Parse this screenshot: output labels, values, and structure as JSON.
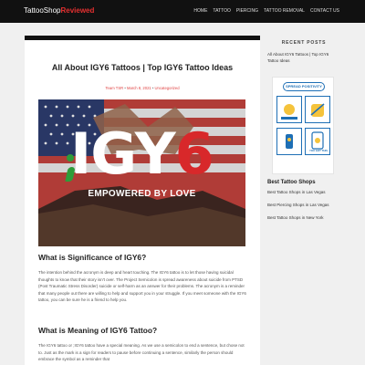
{
  "site": {
    "logo_part1": "TattooShop",
    "logo_part2": "Reviewed"
  },
  "nav": {
    "items": [
      "HOME",
      "TATTOO",
      "PIERCING",
      "TATTOO REMOVAL",
      "CONTACT US"
    ]
  },
  "article": {
    "title": "All About IGY6 Tattoos | Top IGY6 Tattoo Ideas",
    "author": "Team TSR",
    "date": "March 8, 2021",
    "category": "Uncategorized",
    "hero": {
      "text_white": "IGY",
      "text_red": "6",
      "subtitle": "EMPOWERED BY LOVE"
    },
    "heading1": "What is Significance of IGY6?",
    "para1": "The intention behind the acronym is deep and heart touching. The IGY6 tattoo is to let those having suicidal thoughts to know that their story isn't over. The Project Semicolon is spread awareness about suicide from PTSD (Post Traumatic Stress Disorder) suicide or self-harm as an answer for their problems. The acronym is a reminder that many people out there are willing to help and support you in your struggle. If you meet someone with the IGY6 tattoo, you can be sure he is a friend to help you.",
    "heading2": "What is Meaning of IGY6 Tattoo?",
    "para2": "The IGY6 tattoo or ;IGY6 tattoo have a special meaning. As we use a semicolon to end a sentence, but chose not to. Just as the mark is a sign for readers to pause before continuing a sentence, similarly the person should embrace the symbol as a reminder that"
  },
  "sidebar": {
    "recent_heading": "RECENT POSTS",
    "recent_link": "All About IGY6 Tattoos | Top IGY6 Tattoo Ideas",
    "ad_title": "SPREAD POSITIVITY",
    "ad_caption": "YOU GOT THIS",
    "best_heading": "Best Tattoo Shops",
    "best_links": [
      "Best Tattoo Shops in Las Vegas",
      "Best Piercing Shops in Las Vegas",
      "Best Tattoo Shops in New York"
    ]
  },
  "colors": {
    "topbar": "#111111",
    "accent_red": "#e53030",
    "semicolon_green": "#2e9d3a",
    "ad_blue": "#1e6fb5"
  }
}
